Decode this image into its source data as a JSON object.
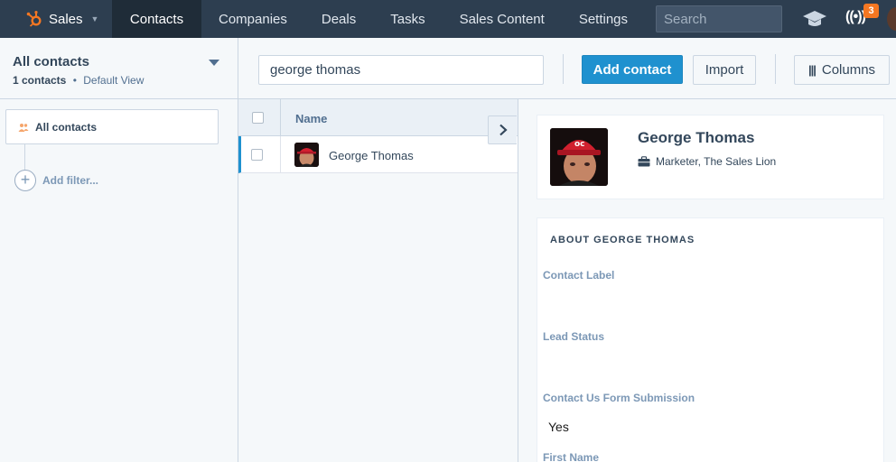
{
  "nav": {
    "brand": "Sales",
    "tabs": [
      {
        "label": "Contacts",
        "active": true
      },
      {
        "label": "Companies",
        "active": false
      },
      {
        "label": "Deals",
        "active": false
      },
      {
        "label": "Tasks",
        "active": false
      },
      {
        "label": "Sales Content",
        "active": false
      },
      {
        "label": "Settings",
        "active": false
      }
    ],
    "search_placeholder": "Search",
    "notification_count": "3"
  },
  "sidebar": {
    "view_title": "All contacts",
    "contact_count": "1 contacts",
    "separator": "•",
    "view_type": "Default View",
    "filter_label": "All contacts",
    "add_filter_label": "Add filter..."
  },
  "toolbar": {
    "search_value": "george thomas",
    "add_contact_label": "Add contact",
    "import_label": "Import",
    "columns_label": "Columns"
  },
  "table": {
    "columns": [
      "Name"
    ],
    "rows": [
      {
        "name": "George Thomas"
      }
    ]
  },
  "record": {
    "name": "George Thomas",
    "job": "Marketer, The Sales Lion",
    "about_title": "ABOUT GEORGE THOMAS",
    "properties": [
      {
        "label": "Contact Label",
        "value": ""
      },
      {
        "label": "Lead Status",
        "value": ""
      },
      {
        "label": "Contact Us Form Submission",
        "value": "Yes"
      },
      {
        "label": "First Name",
        "value": ""
      }
    ]
  },
  "colors": {
    "nav_bg": "#2d3e50",
    "accent": "#1f91cf",
    "brand_orange": "#f57722"
  }
}
